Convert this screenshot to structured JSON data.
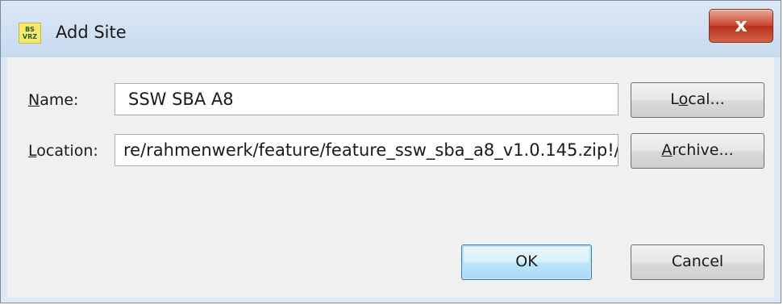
{
  "window": {
    "title": "Add Site",
    "icon_text_top": "BS",
    "icon_text_bottom": "VRZ",
    "close_glyph": "x"
  },
  "form": {
    "name_label_mnemonic": "N",
    "name_label_rest": "ame:",
    "name_value": "SSW SBA A8",
    "location_label_mnemonic": "L",
    "location_label_rest": "ocation:",
    "location_value": "re/rahmenwerk/feature/feature_ssw_sba_a8_v1.0.145.zip!/"
  },
  "buttons": {
    "local_pre": "L",
    "local_mnemonic": "o",
    "local_post": "cal...",
    "archive_mnemonic": "A",
    "archive_post": "rchive...",
    "ok": "OK",
    "cancel": "Cancel"
  }
}
